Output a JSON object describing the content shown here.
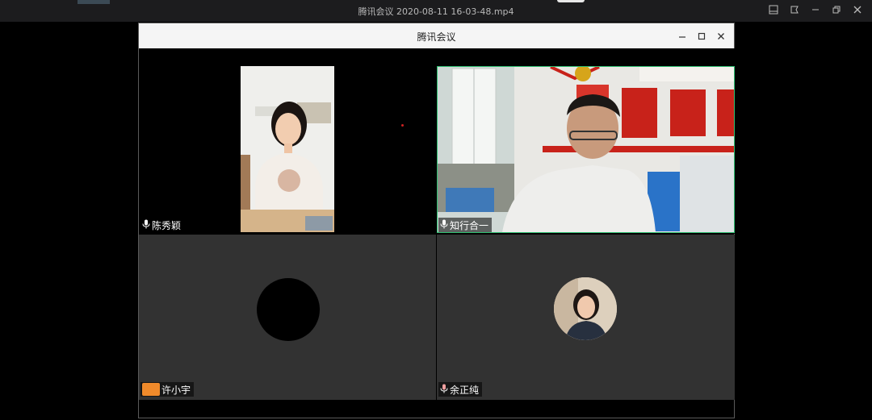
{
  "player": {
    "file_title": "腾讯会议 2020-08-11 16-03-48.mp4"
  },
  "meeting": {
    "window_title": "腾讯会议"
  },
  "participants": [
    {
      "name": "陈秀颖",
      "icon": "microphone-icon"
    },
    {
      "name": "知行合一",
      "icon": "microphone-icon"
    },
    {
      "name": "许小宇",
      "icon": "avatar-badge-icon"
    },
    {
      "name": "余正纯",
      "icon": "microphone-icon"
    }
  ],
  "colors": {
    "active_speaker_border": "#2fbf71",
    "tile_background": "#323232",
    "titlebar": "#f5f5f5"
  }
}
